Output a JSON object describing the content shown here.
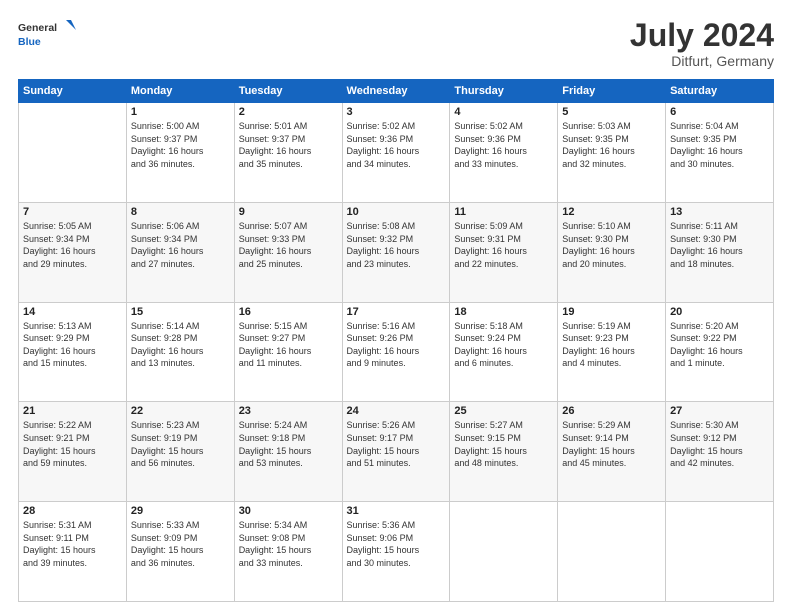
{
  "logo": {
    "line1": "General",
    "line2": "Blue"
  },
  "title": "July 2024",
  "location": "Ditfurt, Germany",
  "weekdays": [
    "Sunday",
    "Monday",
    "Tuesday",
    "Wednesday",
    "Thursday",
    "Friday",
    "Saturday"
  ],
  "weeks": [
    [
      {
        "day": "",
        "info": ""
      },
      {
        "day": "1",
        "info": "Sunrise: 5:00 AM\nSunset: 9:37 PM\nDaylight: 16 hours\nand 36 minutes."
      },
      {
        "day": "2",
        "info": "Sunrise: 5:01 AM\nSunset: 9:37 PM\nDaylight: 16 hours\nand 35 minutes."
      },
      {
        "day": "3",
        "info": "Sunrise: 5:02 AM\nSunset: 9:36 PM\nDaylight: 16 hours\nand 34 minutes."
      },
      {
        "day": "4",
        "info": "Sunrise: 5:02 AM\nSunset: 9:36 PM\nDaylight: 16 hours\nand 33 minutes."
      },
      {
        "day": "5",
        "info": "Sunrise: 5:03 AM\nSunset: 9:35 PM\nDaylight: 16 hours\nand 32 minutes."
      },
      {
        "day": "6",
        "info": "Sunrise: 5:04 AM\nSunset: 9:35 PM\nDaylight: 16 hours\nand 30 minutes."
      }
    ],
    [
      {
        "day": "7",
        "info": "Sunrise: 5:05 AM\nSunset: 9:34 PM\nDaylight: 16 hours\nand 29 minutes."
      },
      {
        "day": "8",
        "info": "Sunrise: 5:06 AM\nSunset: 9:34 PM\nDaylight: 16 hours\nand 27 minutes."
      },
      {
        "day": "9",
        "info": "Sunrise: 5:07 AM\nSunset: 9:33 PM\nDaylight: 16 hours\nand 25 minutes."
      },
      {
        "day": "10",
        "info": "Sunrise: 5:08 AM\nSunset: 9:32 PM\nDaylight: 16 hours\nand 23 minutes."
      },
      {
        "day": "11",
        "info": "Sunrise: 5:09 AM\nSunset: 9:31 PM\nDaylight: 16 hours\nand 22 minutes."
      },
      {
        "day": "12",
        "info": "Sunrise: 5:10 AM\nSunset: 9:30 PM\nDaylight: 16 hours\nand 20 minutes."
      },
      {
        "day": "13",
        "info": "Sunrise: 5:11 AM\nSunset: 9:30 PM\nDaylight: 16 hours\nand 18 minutes."
      }
    ],
    [
      {
        "day": "14",
        "info": "Sunrise: 5:13 AM\nSunset: 9:29 PM\nDaylight: 16 hours\nand 15 minutes."
      },
      {
        "day": "15",
        "info": "Sunrise: 5:14 AM\nSunset: 9:28 PM\nDaylight: 16 hours\nand 13 minutes."
      },
      {
        "day": "16",
        "info": "Sunrise: 5:15 AM\nSunset: 9:27 PM\nDaylight: 16 hours\nand 11 minutes."
      },
      {
        "day": "17",
        "info": "Sunrise: 5:16 AM\nSunset: 9:26 PM\nDaylight: 16 hours\nand 9 minutes."
      },
      {
        "day": "18",
        "info": "Sunrise: 5:18 AM\nSunset: 9:24 PM\nDaylight: 16 hours\nand 6 minutes."
      },
      {
        "day": "19",
        "info": "Sunrise: 5:19 AM\nSunset: 9:23 PM\nDaylight: 16 hours\nand 4 minutes."
      },
      {
        "day": "20",
        "info": "Sunrise: 5:20 AM\nSunset: 9:22 PM\nDaylight: 16 hours\nand 1 minute."
      }
    ],
    [
      {
        "day": "21",
        "info": "Sunrise: 5:22 AM\nSunset: 9:21 PM\nDaylight: 15 hours\nand 59 minutes."
      },
      {
        "day": "22",
        "info": "Sunrise: 5:23 AM\nSunset: 9:19 PM\nDaylight: 15 hours\nand 56 minutes."
      },
      {
        "day": "23",
        "info": "Sunrise: 5:24 AM\nSunset: 9:18 PM\nDaylight: 15 hours\nand 53 minutes."
      },
      {
        "day": "24",
        "info": "Sunrise: 5:26 AM\nSunset: 9:17 PM\nDaylight: 15 hours\nand 51 minutes."
      },
      {
        "day": "25",
        "info": "Sunrise: 5:27 AM\nSunset: 9:15 PM\nDaylight: 15 hours\nand 48 minutes."
      },
      {
        "day": "26",
        "info": "Sunrise: 5:29 AM\nSunset: 9:14 PM\nDaylight: 15 hours\nand 45 minutes."
      },
      {
        "day": "27",
        "info": "Sunrise: 5:30 AM\nSunset: 9:12 PM\nDaylight: 15 hours\nand 42 minutes."
      }
    ],
    [
      {
        "day": "28",
        "info": "Sunrise: 5:31 AM\nSunset: 9:11 PM\nDaylight: 15 hours\nand 39 minutes."
      },
      {
        "day": "29",
        "info": "Sunrise: 5:33 AM\nSunset: 9:09 PM\nDaylight: 15 hours\nand 36 minutes."
      },
      {
        "day": "30",
        "info": "Sunrise: 5:34 AM\nSunset: 9:08 PM\nDaylight: 15 hours\nand 33 minutes."
      },
      {
        "day": "31",
        "info": "Sunrise: 5:36 AM\nSunset: 9:06 PM\nDaylight: 15 hours\nand 30 minutes."
      },
      {
        "day": "",
        "info": ""
      },
      {
        "day": "",
        "info": ""
      },
      {
        "day": "",
        "info": ""
      }
    ]
  ]
}
